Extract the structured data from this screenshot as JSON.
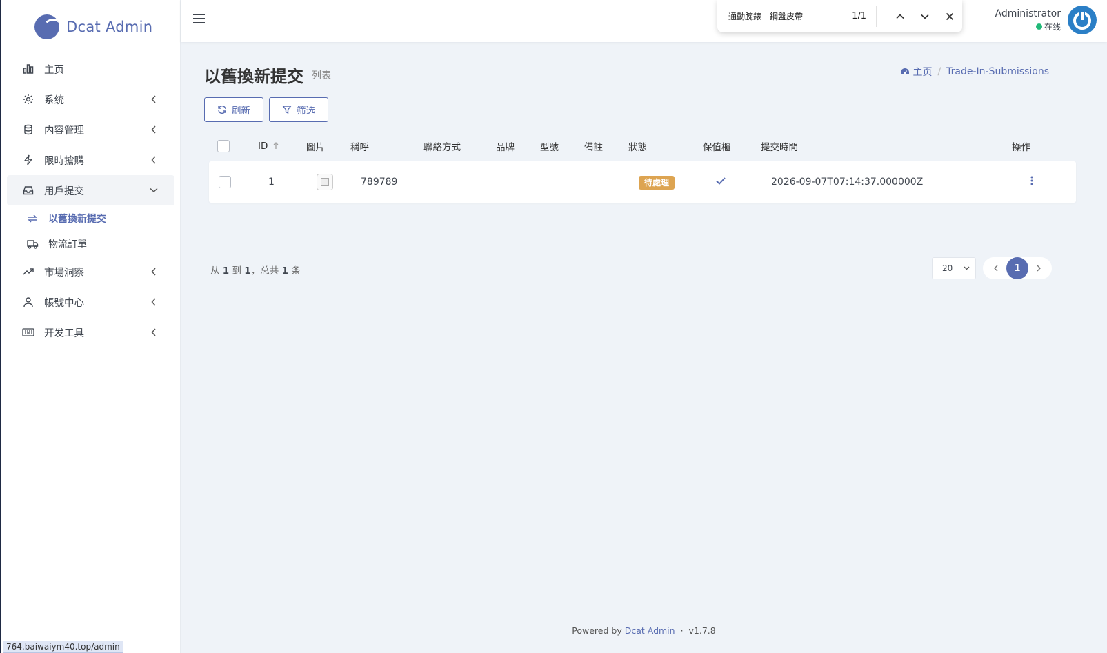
{
  "brand": {
    "name": "Dcat Admin"
  },
  "sidebar": {
    "items": [
      {
        "label": "主页",
        "icon": "bar-chart-icon"
      },
      {
        "label": "系统",
        "icon": "gear-icon"
      },
      {
        "label": "内容管理",
        "icon": "database-icon"
      },
      {
        "label": "限時搶購",
        "icon": "lightning-icon"
      },
      {
        "label": "用戶提交",
        "icon": "inbox-icon"
      },
      {
        "label": "市場洞察",
        "icon": "trend-icon"
      },
      {
        "label": "帳號中心",
        "icon": "user-icon"
      },
      {
        "label": "开发工具",
        "icon": "keyboard-icon"
      }
    ],
    "submenu": [
      {
        "label": "以舊換新提交",
        "icon": "exchange-icon"
      },
      {
        "label": "物流訂單",
        "icon": "truck-icon"
      }
    ]
  },
  "status_url": "764.baiwaiym40.top/admin",
  "findbar": {
    "query": "通勤腕錶 - 鋼盤皮帶",
    "count": "1/1"
  },
  "user": {
    "name": "Administrator",
    "status": "在线"
  },
  "page": {
    "title": "以舊換新提交",
    "subtitle": "列表"
  },
  "breadcrumb": {
    "home": "主页",
    "current": "Trade-In-Submissions"
  },
  "toolbar": {
    "refresh": "刷新",
    "filter": "筛选"
  },
  "table": {
    "headers": [
      "ID",
      "圖片",
      "稱呼",
      "聯絡方式",
      "品牌",
      "型號",
      "備註",
      "狀態",
      "保值櫃",
      "提交時間",
      "操作"
    ],
    "rows": [
      {
        "id": "1",
        "name": "789789",
        "contact": "",
        "brand": "",
        "model": "",
        "note": "",
        "status": "待處理",
        "time": "2026-09-07T07:14:37.000000Z"
      }
    ]
  },
  "summary": {
    "prefix": "从",
    "from": "1",
    "to_word": "到",
    "to": "1",
    "total_word": "，总共",
    "total": "1",
    "unit": "条"
  },
  "pager": {
    "per_page": "20",
    "current": "1"
  },
  "footer": {
    "powered": "Powered by",
    "link": "Dcat Admin",
    "sep": "·",
    "version": "v1.7.8"
  },
  "colors": {
    "primary": "#586cb1",
    "warning": "#dda451",
    "online": "#21b978"
  }
}
